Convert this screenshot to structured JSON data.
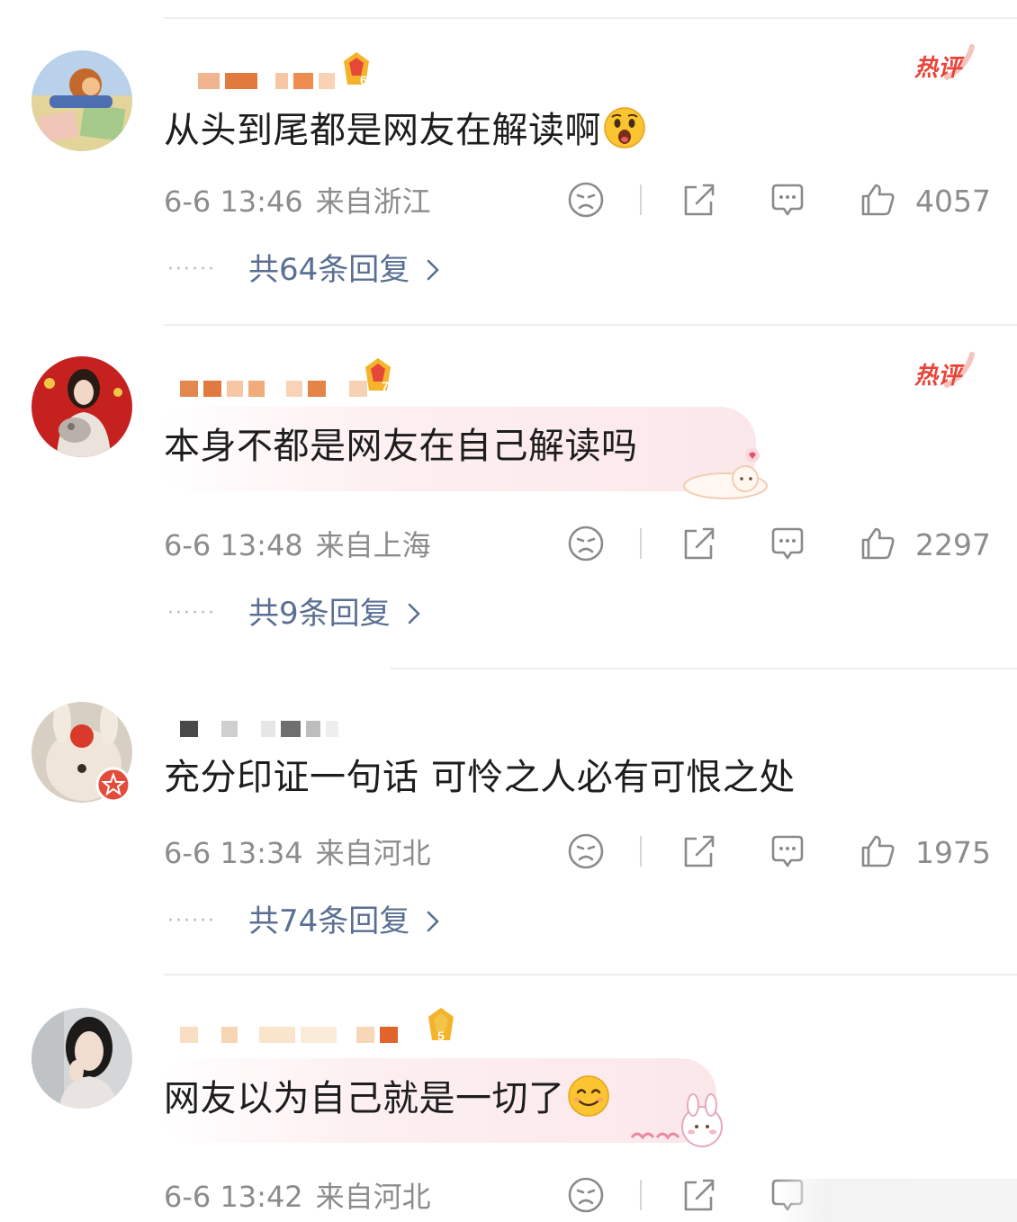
{
  "comments": [
    {
      "text": "从头到尾都是网友在解读啊",
      "emoji": "shocked-face-emoji",
      "time": "6-6 13:46",
      "location": "来自浙江",
      "likes": "4057",
      "replies": "共64条回复",
      "hot_label": "热评",
      "rank_badge": "6"
    },
    {
      "text": "本身不都是网友在自己解读吗",
      "emoji": "",
      "time": "6-6 13:48",
      "location": "来自上海",
      "likes": "2297",
      "replies": "共9条回复",
      "hot_label": "热评",
      "rank_badge": "7"
    },
    {
      "text": "充分印证一句话 可怜之人必有可恨之处",
      "emoji": "",
      "time": "6-6 13:34",
      "location": "来自河北",
      "likes": "1975",
      "replies": "共74条回复",
      "hot_label": "",
      "rank_badge": ""
    },
    {
      "text": "网友以为自己就是一切了",
      "emoji": "smiling-face-emoji",
      "time": "6-6 13:42",
      "location": "来自河北",
      "likes": "",
      "replies": "",
      "hot_label": "",
      "rank_badge": "5"
    }
  ],
  "colors": {
    "hot_tag": "#e8443a",
    "reply_link": "#5a6f93",
    "meta_text": "#8c8c8c",
    "badge_gold": "#f0a41e"
  }
}
